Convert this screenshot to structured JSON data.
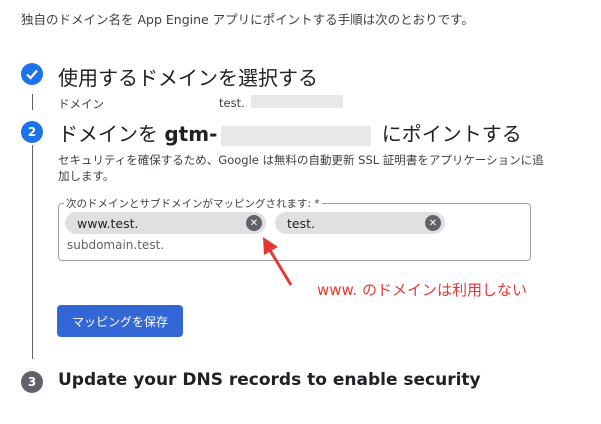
{
  "intro": "独自のドメイン名を App Engine アプリにポイントする手順は次のとおりです。",
  "steps": [
    {
      "number": "1",
      "icon": "check-icon",
      "title": "使用するドメインを選択する"
    },
    {
      "number": "2",
      "title_prefix": "ドメインを ",
      "title_bold": "gtm-",
      "title_suffix": " にポイントする"
    },
    {
      "number": "3",
      "title": "Update your DNS records to enable security"
    }
  ],
  "domain": {
    "label": "ドメイン",
    "value": "test."
  },
  "description": "セキュリティを確保するため、Google は無料の自動更新 SSL 証明書をアプリケーションに追加します。",
  "mapping_field": {
    "legend": "次のドメインとサブドメインがマッピングされます: *",
    "chips": [
      {
        "label": "www.test."
      },
      {
        "label": "test."
      }
    ],
    "subdomain": "subdomain.test."
  },
  "annotation": "www. のドメインは利用しない",
  "save_button": "マッピングを保存",
  "colors": {
    "primary": "#1a73e8",
    "button": "#3367d6",
    "annotation": "#e53935"
  }
}
